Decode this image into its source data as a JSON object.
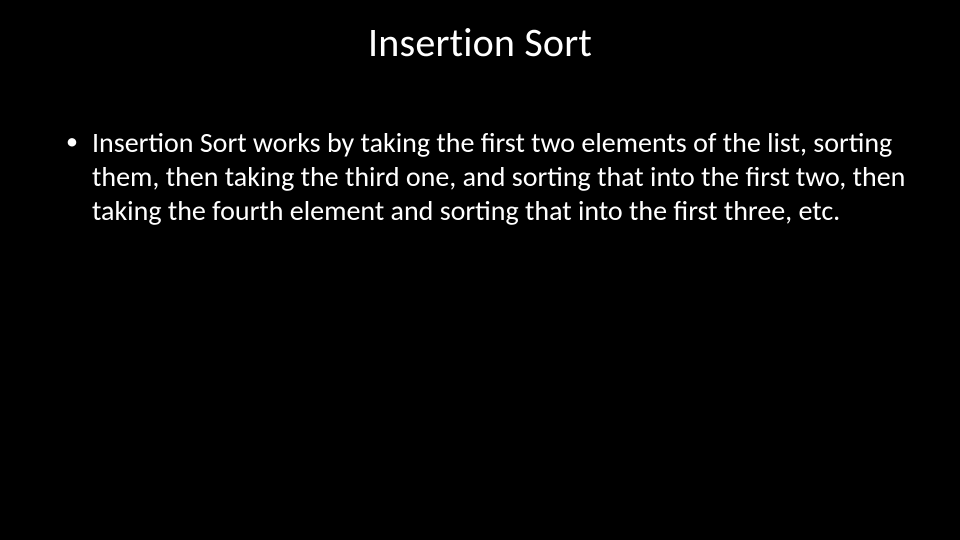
{
  "slide": {
    "title": "Insertion Sort",
    "bullets": [
      "Insertion Sort works by taking the first two elements of the list, sorting them, then taking the third one, and sorting that into the first two, then taking the fourth element and sorting that into the first three, etc."
    ]
  }
}
